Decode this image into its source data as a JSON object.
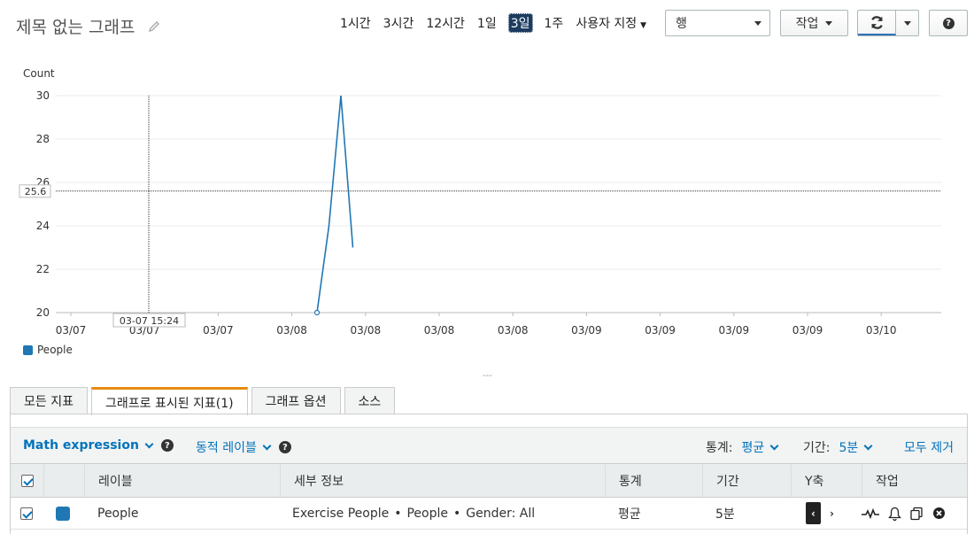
{
  "header": {
    "title": "제목 없는 그래프",
    "time_ranges": [
      "1시간",
      "3시간",
      "12시간",
      "1일",
      "3일",
      "1주"
    ],
    "active_range": "3일",
    "custom_range": "사용자 지정",
    "view_select": "행",
    "actions_label": "작업"
  },
  "chart_data": {
    "type": "line",
    "ylabel": "Count",
    "ylim": [
      20,
      30
    ],
    "yticks": [
      20,
      22,
      24,
      26,
      28,
      30
    ],
    "xtick_labels": [
      "03/07",
      "03/07",
      "03/07",
      "03/08",
      "03/08",
      "03/08",
      "03/08",
      "03/09",
      "03/09",
      "03/09",
      "03/09",
      "03/10"
    ],
    "series": [
      {
        "name": "People",
        "color": "#1f77b4",
        "points": [
          [
            0,
            20
          ],
          [
            1,
            24
          ],
          [
            2,
            30
          ],
          [
            3,
            23
          ]
        ]
      }
    ],
    "crosshair": {
      "y_value": "25.6",
      "x_value": "03-07 15:24"
    },
    "grid": true,
    "legend": "bottom-left"
  },
  "tabs": [
    "모든 지표",
    "그래프로 표시된 지표(1)",
    "그래프 옵션",
    "소스"
  ],
  "active_tab": 1,
  "toolbar": {
    "math_expression": "Math expression",
    "dynamic_label": "동적 레이블",
    "stat_label": "통계:",
    "stat_value": "평균",
    "period_label": "기간:",
    "period_value": "5분",
    "remove_all": "모두 제거"
  },
  "table": {
    "headers": [
      "레이블",
      "세부 정보",
      "통계",
      "기간",
      "Y축",
      "작업"
    ],
    "rows": [
      {
        "label": "People",
        "details_parts": [
          "Exercise People",
          "People",
          "Gender: All"
        ],
        "stat": "평균",
        "period": "5분",
        "color": "#1f77b4"
      }
    ]
  }
}
